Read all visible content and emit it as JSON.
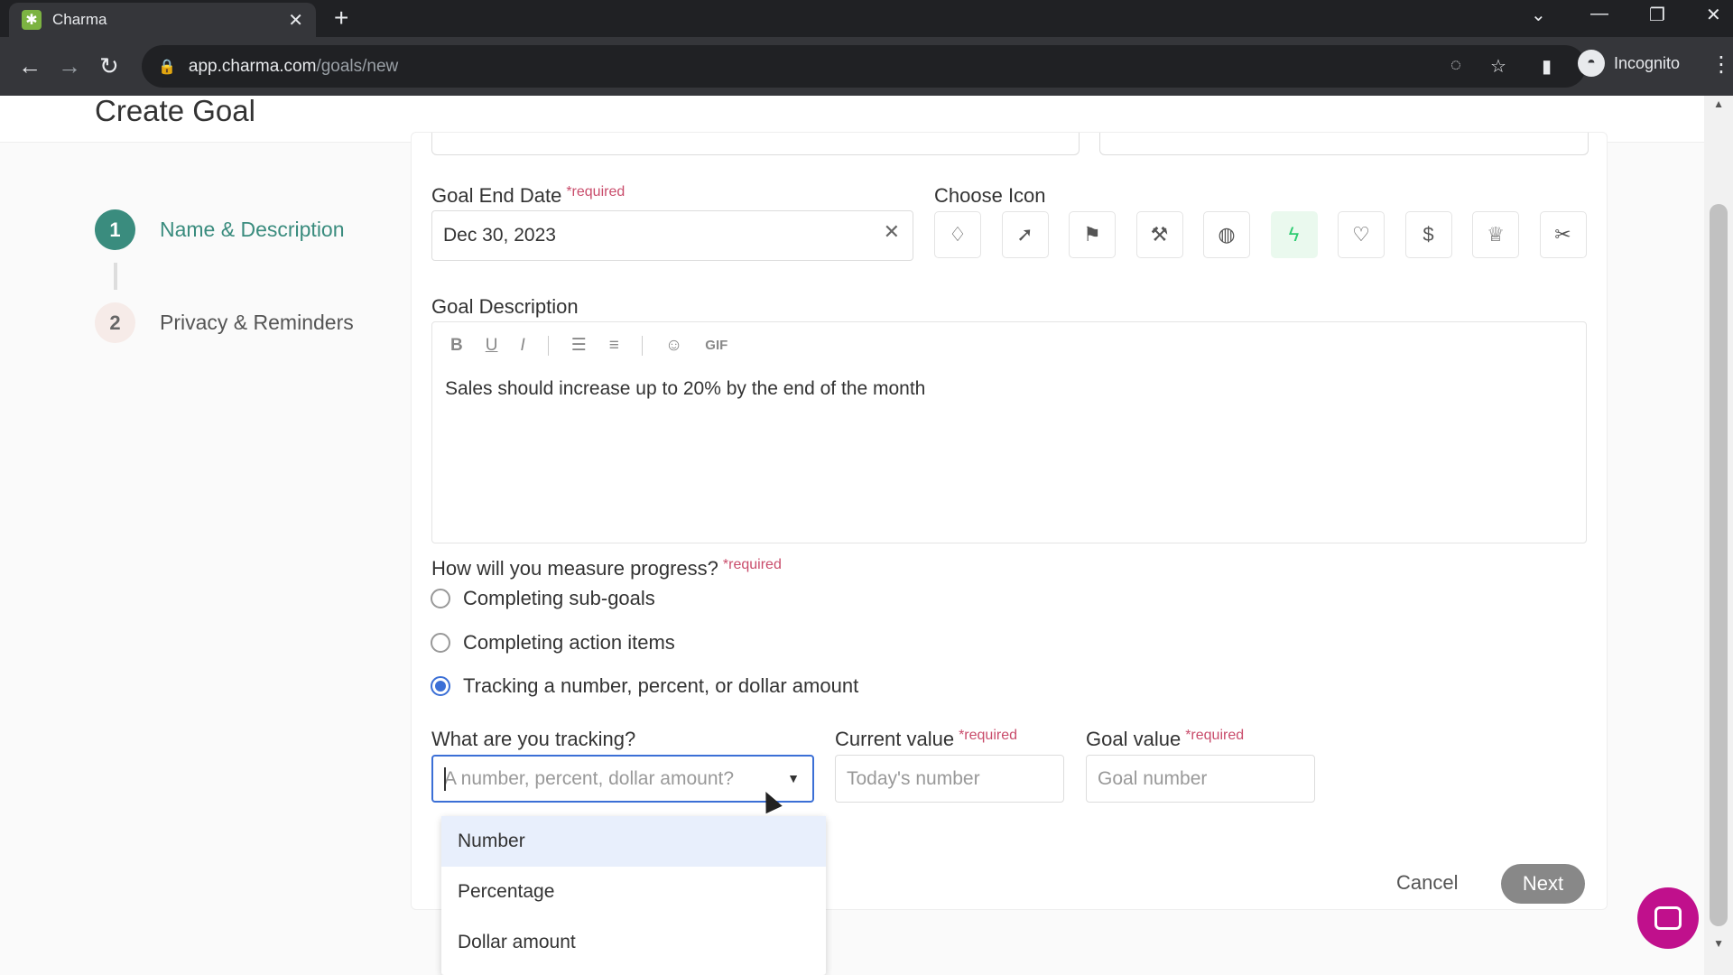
{
  "browser": {
    "tab_title": "Charma",
    "url_host": "app.charma.com",
    "url_path": "/goals/new",
    "profile": "Incognito"
  },
  "page": {
    "title": "Create Goal"
  },
  "stepper": {
    "steps": [
      {
        "num": "1",
        "label": "Name & Description",
        "active": true
      },
      {
        "num": "2",
        "label": "Privacy & Reminders",
        "active": false
      }
    ]
  },
  "form": {
    "end_date": {
      "label": "Goal End Date",
      "required": "*required",
      "value": "Dec 30, 2023"
    },
    "icon": {
      "label": "Choose Icon",
      "icons": [
        "diamond-icon",
        "rocket-icon",
        "flag-icon",
        "hammer-icon",
        "apple-icon",
        "bolt-icon",
        "heart-icon",
        "dollar-icon",
        "trophy-icon",
        "scissors-icon"
      ],
      "selected": "bolt-icon"
    },
    "description": {
      "label": "Goal Description",
      "toolbar": [
        "B",
        "U",
        "I",
        "list",
        "numbered-list",
        "emoji",
        "GIF"
      ],
      "gif_label": "GIF",
      "text": "Sales should increase up to 20% by the end of the month"
    },
    "measure": {
      "label": "How will you measure progress?",
      "required": "*required",
      "options": [
        "Completing sub-goals",
        "Completing action items",
        "Tracking a number, percent, or dollar amount"
      ],
      "selected_index": 2
    },
    "tracking": {
      "label": "What are you tracking?",
      "placeholder": "A number, percent, dollar amount?",
      "options": [
        "Number",
        "Percentage",
        "Dollar amount"
      ],
      "highlighted_index": 0
    },
    "current_value": {
      "label": "Current value",
      "required": "*required",
      "placeholder": "Today's number"
    },
    "goal_value": {
      "label": "Goal value",
      "required": "*required",
      "placeholder": "Goal number"
    }
  },
  "actions": {
    "cancel": "Cancel",
    "next": "Next"
  }
}
